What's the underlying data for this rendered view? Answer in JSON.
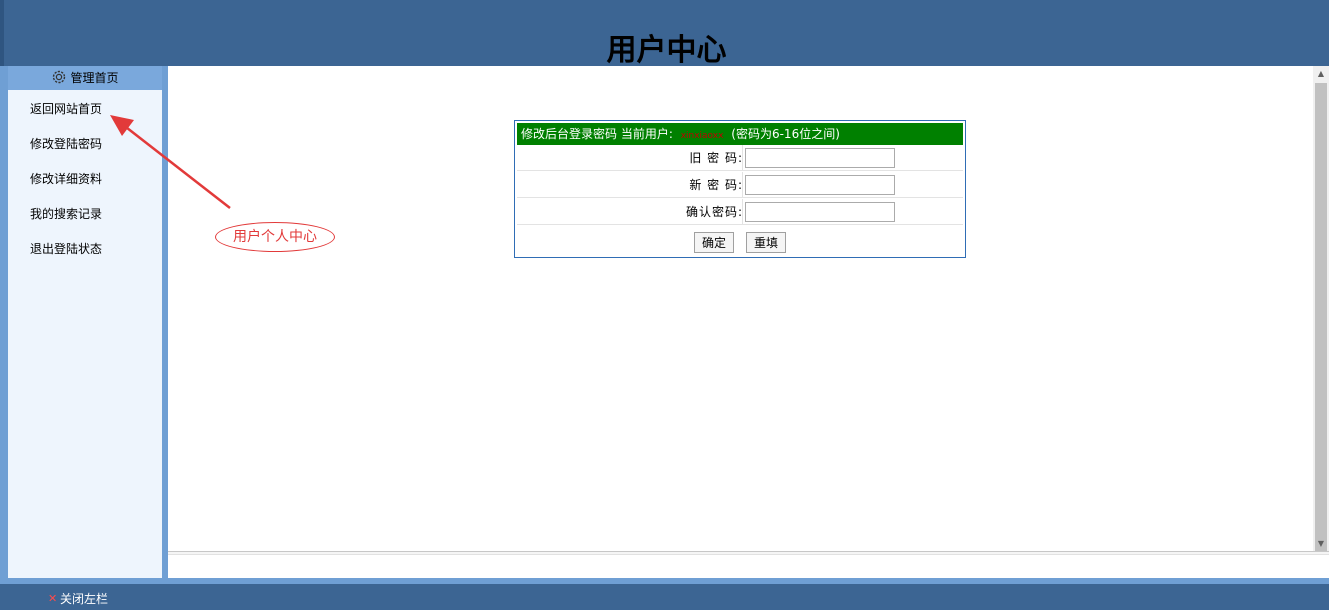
{
  "header": {
    "title": "用户中心"
  },
  "sidebar": {
    "head_label": "管理首页",
    "head_icon": "gear-icon",
    "items": [
      {
        "label": "返回网站首页"
      },
      {
        "label": "修改登陆密码"
      },
      {
        "label": "修改详细资料"
      },
      {
        "label": "我的搜索记录"
      },
      {
        "label": "退出登陆状态"
      }
    ]
  },
  "password_form": {
    "head_prefix": "修改后台登录密码 当前用户:",
    "current_user": "xinxiaoxx",
    "head_note": "(密码为6-16位之间)",
    "fields": [
      {
        "label": "旧 密 码:",
        "value": ""
      },
      {
        "label": "新 密 码:",
        "value": ""
      },
      {
        "label": "确认密码:",
        "value": ""
      }
    ],
    "confirm_label": "确定",
    "reset_label": "重填",
    "header_color": "#008000"
  },
  "annotation": {
    "text": "用户个人中心",
    "color": "#e23a3a"
  },
  "footer": {
    "close_icon": "close-icon",
    "close_label": "关闭左栏"
  },
  "colors": {
    "brand": "#3c6593",
    "sidebar": "#6f9fd4",
    "sidebar_bg": "#eef5fd"
  }
}
